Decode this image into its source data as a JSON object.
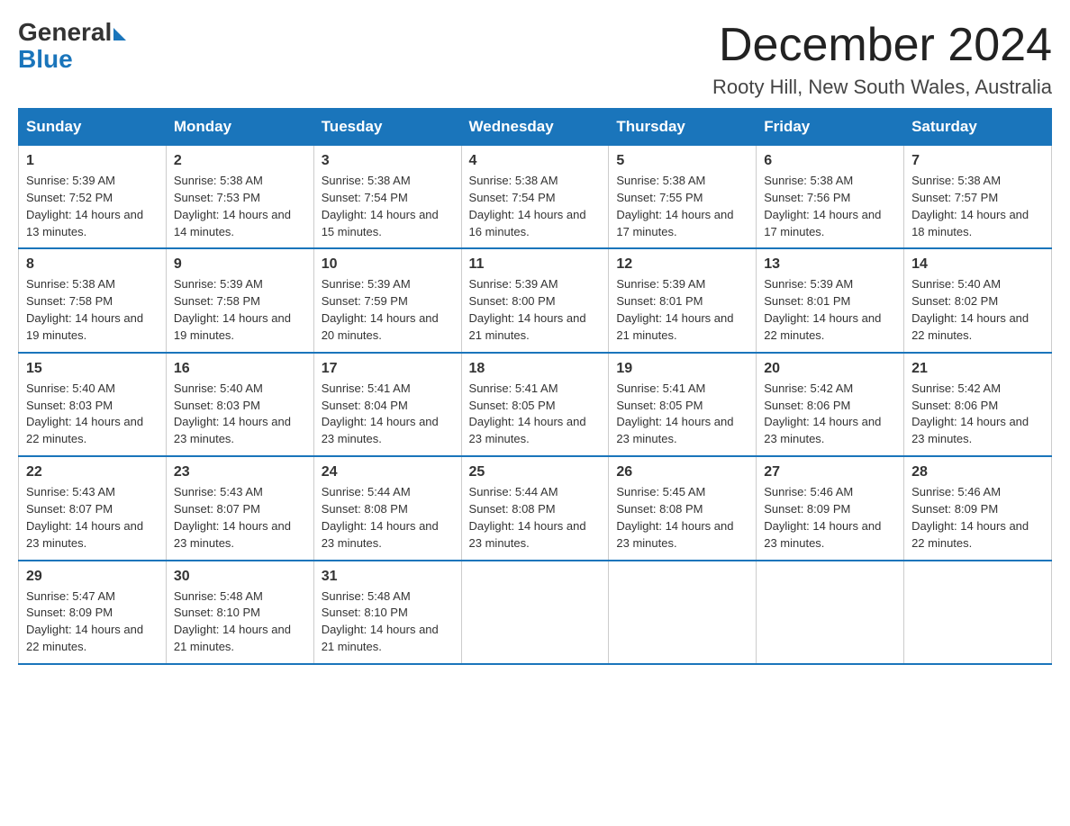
{
  "header": {
    "logo_general": "General",
    "logo_blue": "Blue",
    "month_title": "December 2024",
    "location": "Rooty Hill, New South Wales, Australia"
  },
  "days_of_week": [
    "Sunday",
    "Monday",
    "Tuesday",
    "Wednesday",
    "Thursday",
    "Friday",
    "Saturday"
  ],
  "weeks": [
    [
      {
        "day": "1",
        "sunrise": "5:39 AM",
        "sunset": "7:52 PM",
        "daylight": "14 hours and 13 minutes."
      },
      {
        "day": "2",
        "sunrise": "5:38 AM",
        "sunset": "7:53 PM",
        "daylight": "14 hours and 14 minutes."
      },
      {
        "day": "3",
        "sunrise": "5:38 AM",
        "sunset": "7:54 PM",
        "daylight": "14 hours and 15 minutes."
      },
      {
        "day": "4",
        "sunrise": "5:38 AM",
        "sunset": "7:54 PM",
        "daylight": "14 hours and 16 minutes."
      },
      {
        "day": "5",
        "sunrise": "5:38 AM",
        "sunset": "7:55 PM",
        "daylight": "14 hours and 17 minutes."
      },
      {
        "day": "6",
        "sunrise": "5:38 AM",
        "sunset": "7:56 PM",
        "daylight": "14 hours and 17 minutes."
      },
      {
        "day": "7",
        "sunrise": "5:38 AM",
        "sunset": "7:57 PM",
        "daylight": "14 hours and 18 minutes."
      }
    ],
    [
      {
        "day": "8",
        "sunrise": "5:38 AM",
        "sunset": "7:58 PM",
        "daylight": "14 hours and 19 minutes."
      },
      {
        "day": "9",
        "sunrise": "5:39 AM",
        "sunset": "7:58 PM",
        "daylight": "14 hours and 19 minutes."
      },
      {
        "day": "10",
        "sunrise": "5:39 AM",
        "sunset": "7:59 PM",
        "daylight": "14 hours and 20 minutes."
      },
      {
        "day": "11",
        "sunrise": "5:39 AM",
        "sunset": "8:00 PM",
        "daylight": "14 hours and 21 minutes."
      },
      {
        "day": "12",
        "sunrise": "5:39 AM",
        "sunset": "8:01 PM",
        "daylight": "14 hours and 21 minutes."
      },
      {
        "day": "13",
        "sunrise": "5:39 AM",
        "sunset": "8:01 PM",
        "daylight": "14 hours and 22 minutes."
      },
      {
        "day": "14",
        "sunrise": "5:40 AM",
        "sunset": "8:02 PM",
        "daylight": "14 hours and 22 minutes."
      }
    ],
    [
      {
        "day": "15",
        "sunrise": "5:40 AM",
        "sunset": "8:03 PM",
        "daylight": "14 hours and 22 minutes."
      },
      {
        "day": "16",
        "sunrise": "5:40 AM",
        "sunset": "8:03 PM",
        "daylight": "14 hours and 23 minutes."
      },
      {
        "day": "17",
        "sunrise": "5:41 AM",
        "sunset": "8:04 PM",
        "daylight": "14 hours and 23 minutes."
      },
      {
        "day": "18",
        "sunrise": "5:41 AM",
        "sunset": "8:05 PM",
        "daylight": "14 hours and 23 minutes."
      },
      {
        "day": "19",
        "sunrise": "5:41 AM",
        "sunset": "8:05 PM",
        "daylight": "14 hours and 23 minutes."
      },
      {
        "day": "20",
        "sunrise": "5:42 AM",
        "sunset": "8:06 PM",
        "daylight": "14 hours and 23 minutes."
      },
      {
        "day": "21",
        "sunrise": "5:42 AM",
        "sunset": "8:06 PM",
        "daylight": "14 hours and 23 minutes."
      }
    ],
    [
      {
        "day": "22",
        "sunrise": "5:43 AM",
        "sunset": "8:07 PM",
        "daylight": "14 hours and 23 minutes."
      },
      {
        "day": "23",
        "sunrise": "5:43 AM",
        "sunset": "8:07 PM",
        "daylight": "14 hours and 23 minutes."
      },
      {
        "day": "24",
        "sunrise": "5:44 AM",
        "sunset": "8:08 PM",
        "daylight": "14 hours and 23 minutes."
      },
      {
        "day": "25",
        "sunrise": "5:44 AM",
        "sunset": "8:08 PM",
        "daylight": "14 hours and 23 minutes."
      },
      {
        "day": "26",
        "sunrise": "5:45 AM",
        "sunset": "8:08 PM",
        "daylight": "14 hours and 23 minutes."
      },
      {
        "day": "27",
        "sunrise": "5:46 AM",
        "sunset": "8:09 PM",
        "daylight": "14 hours and 23 minutes."
      },
      {
        "day": "28",
        "sunrise": "5:46 AM",
        "sunset": "8:09 PM",
        "daylight": "14 hours and 22 minutes."
      }
    ],
    [
      {
        "day": "29",
        "sunrise": "5:47 AM",
        "sunset": "8:09 PM",
        "daylight": "14 hours and 22 minutes."
      },
      {
        "day": "30",
        "sunrise": "5:48 AM",
        "sunset": "8:10 PM",
        "daylight": "14 hours and 21 minutes."
      },
      {
        "day": "31",
        "sunrise": "5:48 AM",
        "sunset": "8:10 PM",
        "daylight": "14 hours and 21 minutes."
      },
      null,
      null,
      null,
      null
    ]
  ],
  "labels": {
    "sunrise_prefix": "Sunrise: ",
    "sunset_prefix": "Sunset: ",
    "daylight_prefix": "Daylight: "
  }
}
